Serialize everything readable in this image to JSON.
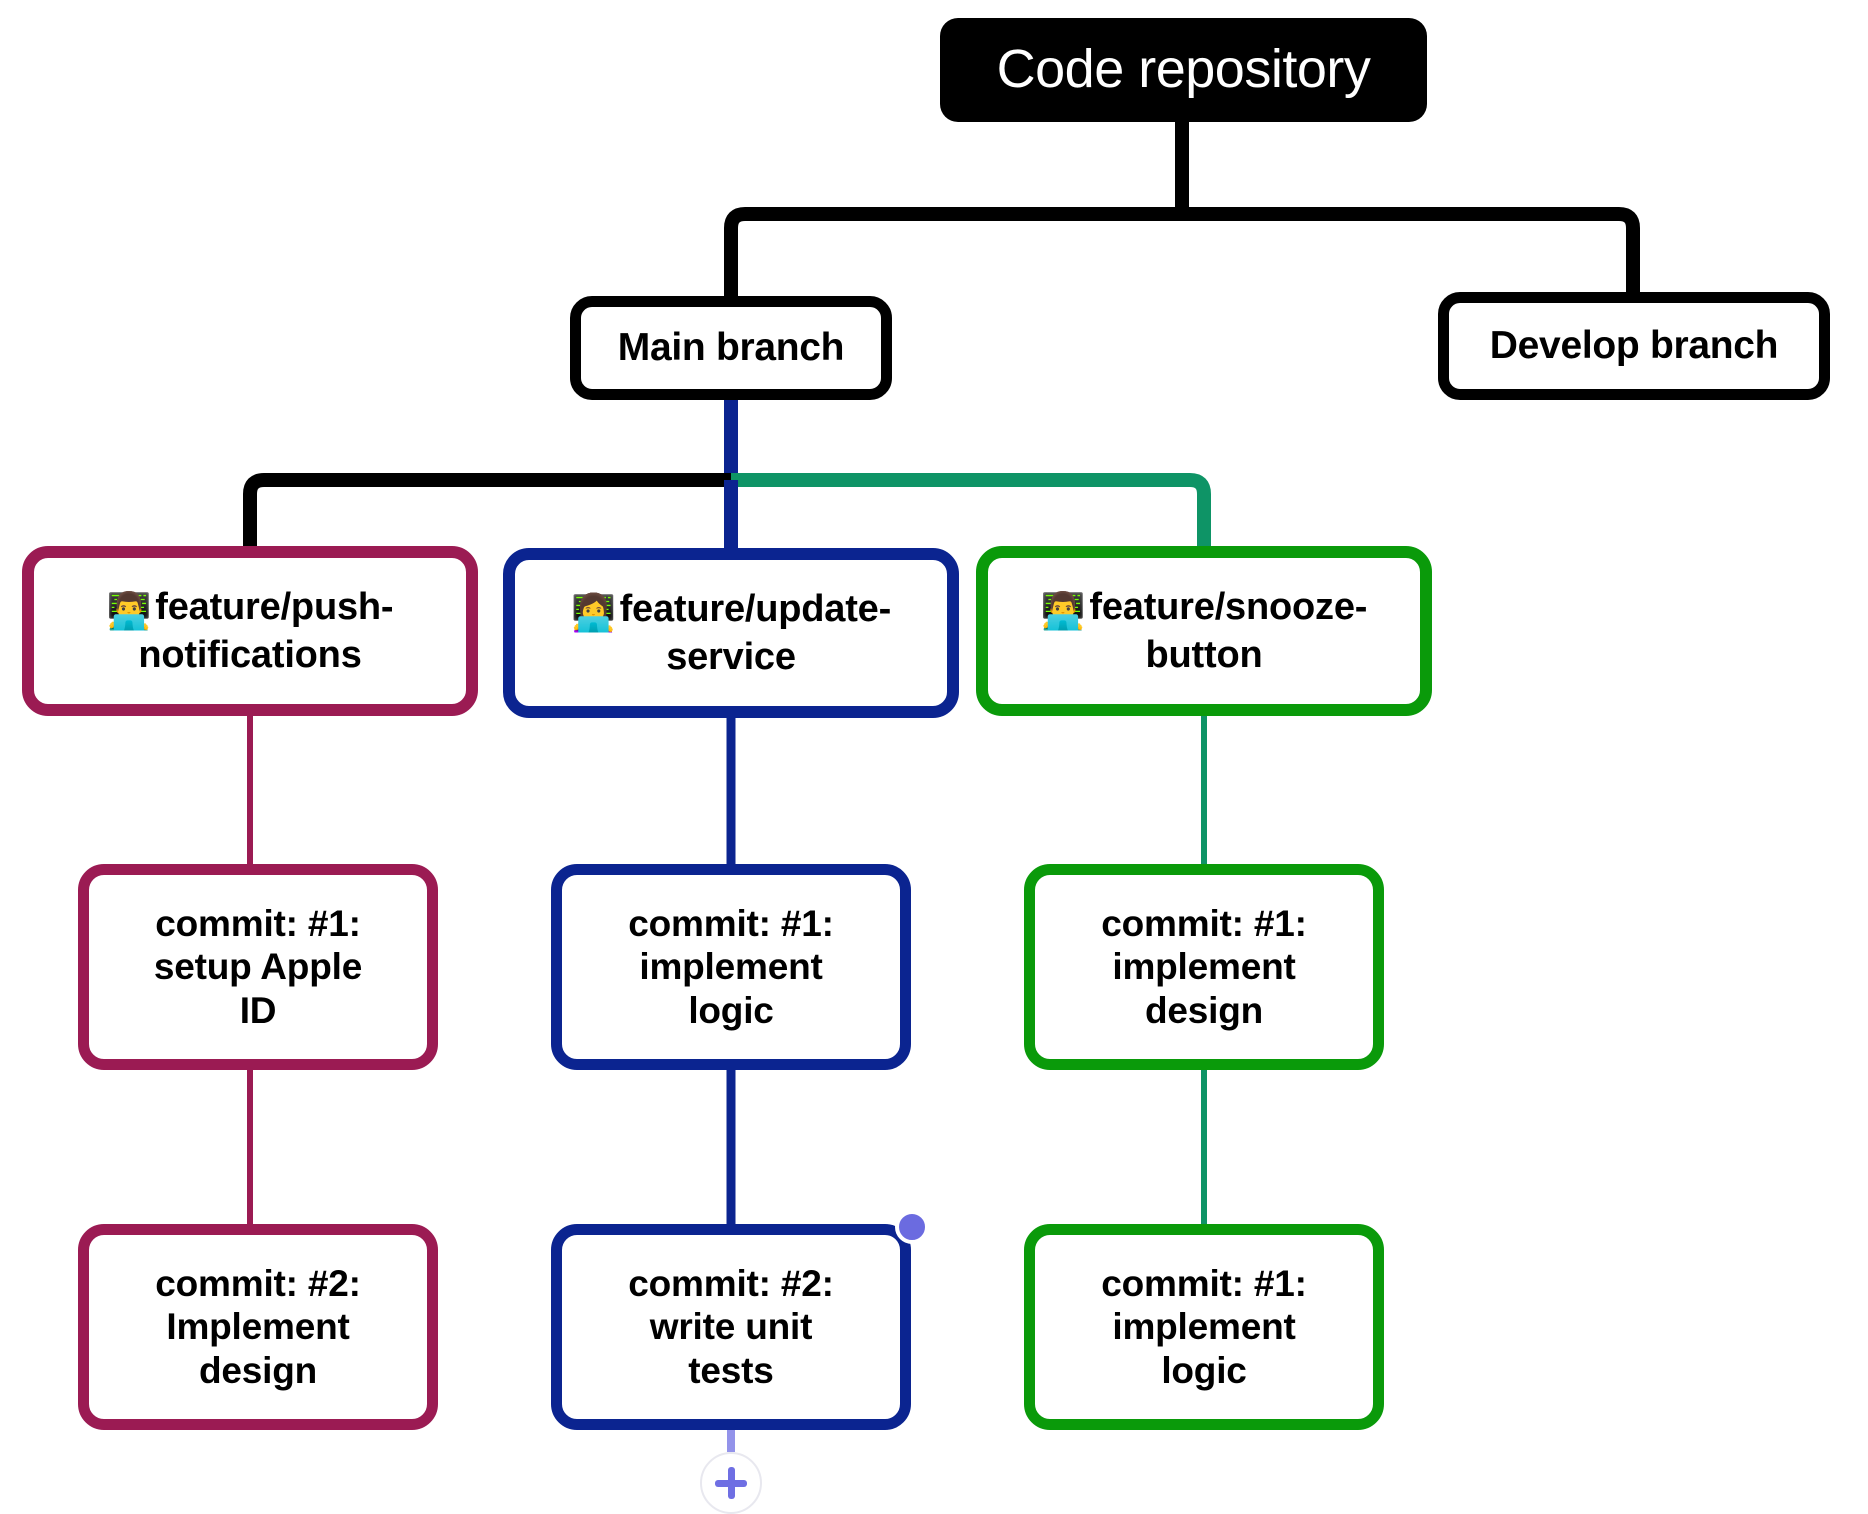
{
  "diagram": {
    "title": "Code repository",
    "background": "#ffffff",
    "colors": {
      "root_fill": "#000000",
      "root_text": "#ffffff",
      "branch_border": "#000000",
      "magenta": "#9b1b53",
      "navy": "#0b2490",
      "green": "#0a9a0a",
      "teal_edge": "#0e9466",
      "selection_dot": "#6b6be0",
      "add_button": "#6f6fe3"
    }
  },
  "nodes": {
    "root": {
      "label": "Code repository"
    },
    "branches": [
      {
        "id": "main",
        "label": "Main branch"
      },
      {
        "id": "develop",
        "label": "Develop branch"
      }
    ],
    "features": [
      {
        "id": "push-notifications",
        "emoji": "👨‍💻",
        "emoji_name": "man-technologist-emoji",
        "line1": "feature/push-",
        "line2": "notifications",
        "color": "#9b1b53"
      },
      {
        "id": "update-service",
        "emoji": "👩‍💻",
        "emoji_name": "woman-technologist-emoji",
        "line1": "feature/update-",
        "line2": "service",
        "color": "#0b2490"
      },
      {
        "id": "snooze-button",
        "emoji": "👨‍💻",
        "emoji_name": "man-technologist-emoji",
        "line1": "feature/snooze-",
        "line2": "button",
        "color": "#0a9a0a"
      }
    ],
    "commits": [
      {
        "id": "push-commit-1",
        "line1": "commit: #1:",
        "line2": "setup Apple",
        "line3": "ID",
        "color": "#9b1b53"
      },
      {
        "id": "update-commit-1",
        "line1": "commit: #1:",
        "line2": "implement",
        "line3": "logic",
        "color": "#0b2490"
      },
      {
        "id": "snooze-commit-1",
        "line1": "commit: #1:",
        "line2": "implement",
        "line3": "design",
        "color": "#0a9a0a"
      },
      {
        "id": "push-commit-2",
        "line1": "commit: #2:",
        "line2": "Implement",
        "line3": "design",
        "color": "#9b1b53"
      },
      {
        "id": "update-commit-2",
        "line1": "commit: #2:",
        "line2": "write unit",
        "line3": "tests",
        "color": "#0b2490",
        "selected": true
      },
      {
        "id": "snooze-commit-2",
        "line1": "commit: #1:",
        "line2": "implement",
        "line3": "logic",
        "color": "#0a9a0a"
      }
    ]
  },
  "controls": {
    "add_child_label": "+"
  }
}
